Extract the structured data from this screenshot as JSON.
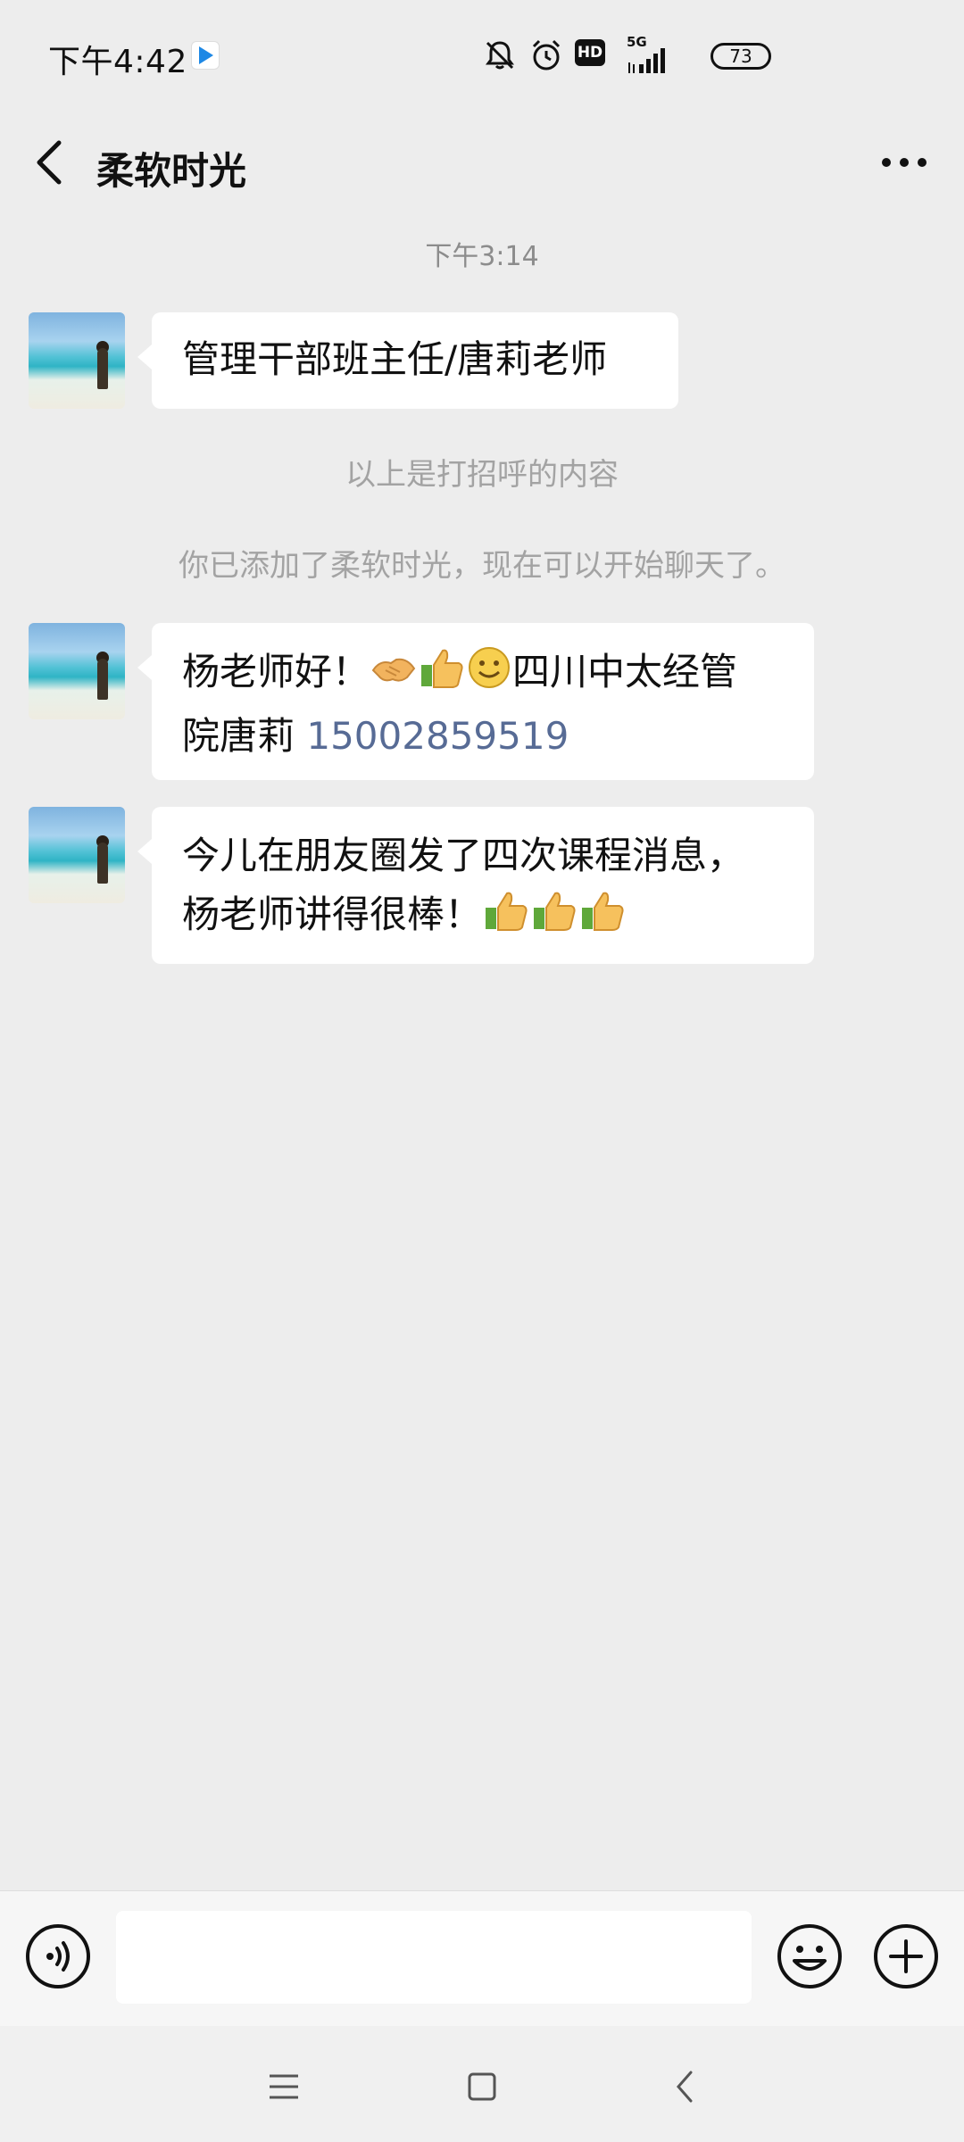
{
  "status_bar": {
    "time": "下午4:42",
    "network": "5G",
    "hd_label": "HD",
    "battery": "73"
  },
  "header": {
    "title": "柔软时光"
  },
  "chat": {
    "timestamp": "下午3:14",
    "messages": [
      {
        "type": "received",
        "text": "管理干部班主任/唐莉老师"
      },
      {
        "type": "system",
        "text": "以上是打招呼的内容"
      },
      {
        "type": "system",
        "text": "你已添加了柔软时光，现在可以开始聊天了。"
      },
      {
        "type": "received",
        "line1": "杨老师好！",
        "line1_rest": "四川中太经管",
        "line2": "院唐莉 ",
        "phone": "15002859519"
      },
      {
        "type": "received",
        "line1": "今儿在朋友圈发了四次课程消息，",
        "line2": "杨老师讲得很棒！"
      }
    ]
  },
  "input": {
    "placeholder": ""
  },
  "colors": {
    "background": "#ededed",
    "bubble": "#ffffff",
    "link": "#576b95",
    "system_text": "#a3a3a3"
  },
  "icons": [
    "back-arrow-icon",
    "more-dots-icon",
    "voice-icon",
    "emoji-icon",
    "plus-icon",
    "handshake-emoji",
    "thumbs-up-emoji",
    "smile-emoji",
    "menu-nav-icon",
    "home-nav-icon",
    "back-nav-icon"
  ]
}
